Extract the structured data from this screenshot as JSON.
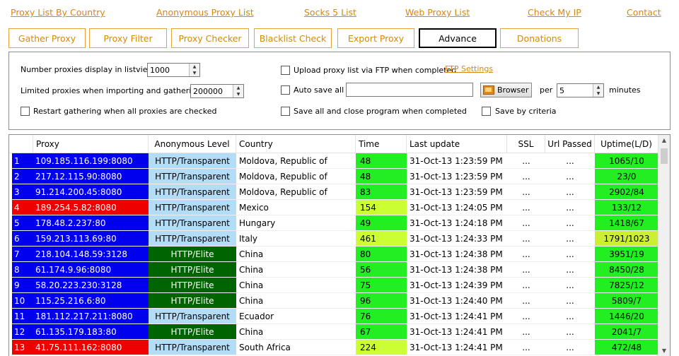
{
  "links": [
    "Proxy List By Country",
    "Anonymous Proxy List",
    "Socks 5 List",
    "Web Proxy List",
    "Check My IP",
    "Contact"
  ],
  "tabs": [
    "Gather Proxy",
    "Proxy Filter",
    "Proxy Checker",
    "Blacklist Check",
    "Export Proxy",
    "Advance",
    "Donations"
  ],
  "active_tab": "Advance",
  "settings": {
    "display_label": "Number proxies display in listview",
    "display_value": "1000",
    "limit_label": "Limited proxies when importing and gathering",
    "limit_value": "200000",
    "restart_label": "Restart gathering when all proxies are checked",
    "upload_label": "Upload proxy list via FTP when completed",
    "ftp_link": "FTP Settings",
    "autosave_label": "Auto save all",
    "autosave_path": "",
    "browser_label": "Browser",
    "per_label": "per",
    "per_value": "5",
    "minutes_label": "minutes",
    "saveclose_label": "Save all and close program when completed",
    "criteria_label": "Save by criteria"
  },
  "grid": {
    "headers": [
      "Proxy",
      "Anonymous Level",
      "Country",
      "Time",
      "Last update",
      "SSL",
      "Url Passed",
      "Uptime(L/D)"
    ],
    "rows": [
      {
        "num": "1",
        "proxy": "109.185.116.199:8080",
        "anon": "HTTP/Transparent",
        "country": "Moldova, Republic of",
        "time": "48",
        "updated": "31-Oct-13 1:23:59 PM",
        "ssl": "...",
        "url": "...",
        "uptime": "1065/10"
      },
      {
        "num": "2",
        "proxy": "217.12.115.90:8080",
        "anon": "HTTP/Transparent",
        "country": "Moldova, Republic of",
        "time": "48",
        "updated": "31-Oct-13 1:23:59 PM",
        "ssl": "...",
        "url": "...",
        "uptime": "23/0"
      },
      {
        "num": "3",
        "proxy": "91.214.200.45:8080",
        "anon": "HTTP/Transparent",
        "country": "Moldova, Republic of",
        "time": "83",
        "updated": "31-Oct-13 1:23:59 PM",
        "ssl": "...",
        "url": "...",
        "uptime": "2902/84"
      },
      {
        "num": "4",
        "proxy": "189.254.5.82:8080",
        "anon": "HTTP/Transparent",
        "country": "Mexico",
        "time": "154",
        "updated": "31-Oct-13 1:24:05 PM",
        "ssl": "...",
        "url": "...",
        "uptime": "133/12"
      },
      {
        "num": "5",
        "proxy": "178.48.2.237:80",
        "anon": "HTTP/Transparent",
        "country": "Hungary",
        "time": "49",
        "updated": "31-Oct-13 1:24:18 PM",
        "ssl": "...",
        "url": "...",
        "uptime": "1418/67"
      },
      {
        "num": "6",
        "proxy": "159.213.113.69:80",
        "anon": "HTTP/Transparent",
        "country": "Italy",
        "time": "461",
        "updated": "31-Oct-13 1:24:33 PM",
        "ssl": "...",
        "url": "...",
        "uptime": "1791/1023"
      },
      {
        "num": "7",
        "proxy": "218.104.148.59:3128",
        "anon": "HTTP/Elite",
        "country": "China",
        "time": "80",
        "updated": "31-Oct-13 1:24:38 PM",
        "ssl": "...",
        "url": "...",
        "uptime": "3951/19"
      },
      {
        "num": "8",
        "proxy": "61.174.9.96:8080",
        "anon": "HTTP/Elite",
        "country": "China",
        "time": "56",
        "updated": "31-Oct-13 1:24:38 PM",
        "ssl": "...",
        "url": "...",
        "uptime": "8450/28"
      },
      {
        "num": "9",
        "proxy": "58.20.223.230:3128",
        "anon": "HTTP/Elite",
        "country": "China",
        "time": "75",
        "updated": "31-Oct-13 1:24:39 PM",
        "ssl": "...",
        "url": "...",
        "uptime": "7825/12"
      },
      {
        "num": "10",
        "proxy": "115.25.216.6:80",
        "anon": "HTTP/Elite",
        "country": "China",
        "time": "96",
        "updated": "31-Oct-13 1:24:40 PM",
        "ssl": "...",
        "url": "...",
        "uptime": "5809/7"
      },
      {
        "num": "11",
        "proxy": "181.112.217.211:8080",
        "anon": "HTTP/Transparent",
        "country": "Ecuador",
        "time": "76",
        "updated": "31-Oct-13 1:24:41 PM",
        "ssl": "...",
        "url": "...",
        "uptime": "1446/20"
      },
      {
        "num": "12",
        "proxy": "61.135.179.183:80",
        "anon": "HTTP/Elite",
        "country": "China",
        "time": "67",
        "updated": "31-Oct-13 1:24:41 PM",
        "ssl": "...",
        "url": "...",
        "uptime": "2041/7"
      },
      {
        "num": "13",
        "proxy": "41.75.111.162:8080",
        "anon": "HTTP/Transparent",
        "country": "South Africa",
        "time": "224",
        "updated": "31-Oct-13 1:24:41 PM",
        "ssl": "...",
        "url": "...",
        "uptime": "472/48"
      }
    ]
  },
  "colors": {
    "link": "#d4890e",
    "row_ok": "#0000ee",
    "row_bad": "#ee0000",
    "transparent": "#b3dcf7",
    "elite": "#006400",
    "time_fast": "#22ee22",
    "time_slow": "#ccff33",
    "uptime_good": "#22ee22",
    "uptime_medium": "#ccee33"
  }
}
